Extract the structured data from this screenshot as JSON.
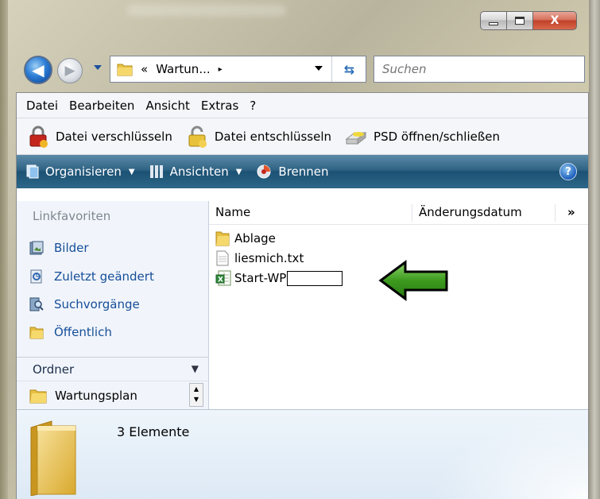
{
  "window": {
    "caption_buttons": {
      "minimize": "minimize",
      "maximize": "maximize",
      "close": "X"
    }
  },
  "address": {
    "back_icon": "back-arrow-icon",
    "forward_icon": "forward-arrow-icon",
    "breadcrumb_prefix": "«",
    "path": "Wartun...",
    "chevron": "▸",
    "search_placeholder": "Suchen"
  },
  "menu": {
    "items": [
      "Datei",
      "Bearbeiten",
      "Ansicht",
      "Extras",
      "?"
    ]
  },
  "custom_toolbar": {
    "items": [
      {
        "label": "Datei verschlüsseln",
        "icon": "lock-closed-icon"
      },
      {
        "label": "Datei entschlüsseln",
        "icon": "lock-open-icon"
      },
      {
        "label": "PSD öffnen/schließen",
        "icon": "drive-icon"
      }
    ]
  },
  "command_bar": {
    "organize": "Organisieren",
    "views": "Ansichten",
    "burn": "Brennen",
    "help": "?"
  },
  "nav_pane": {
    "heading": "Linkfavoriten",
    "links": [
      "Bilder",
      "Zuletzt geändert",
      "Suchvorgänge",
      "Öffentlich"
    ],
    "folders_label": "Ordner",
    "tree_item": "Wartungsplan"
  },
  "file_list": {
    "columns": [
      "Name",
      "Änderungsdatum",
      "»"
    ],
    "files": [
      {
        "name": "Ablage",
        "type": "folder"
      },
      {
        "name": "liesmich.txt",
        "type": "text"
      },
      {
        "name": "Start-WP",
        "type": "excel"
      }
    ]
  },
  "details": {
    "count": "3 Elemente"
  },
  "colors": {
    "accent_blue": "#164e99",
    "command_bar": "#2f6384",
    "arrow_green": "#3c9a1e"
  }
}
